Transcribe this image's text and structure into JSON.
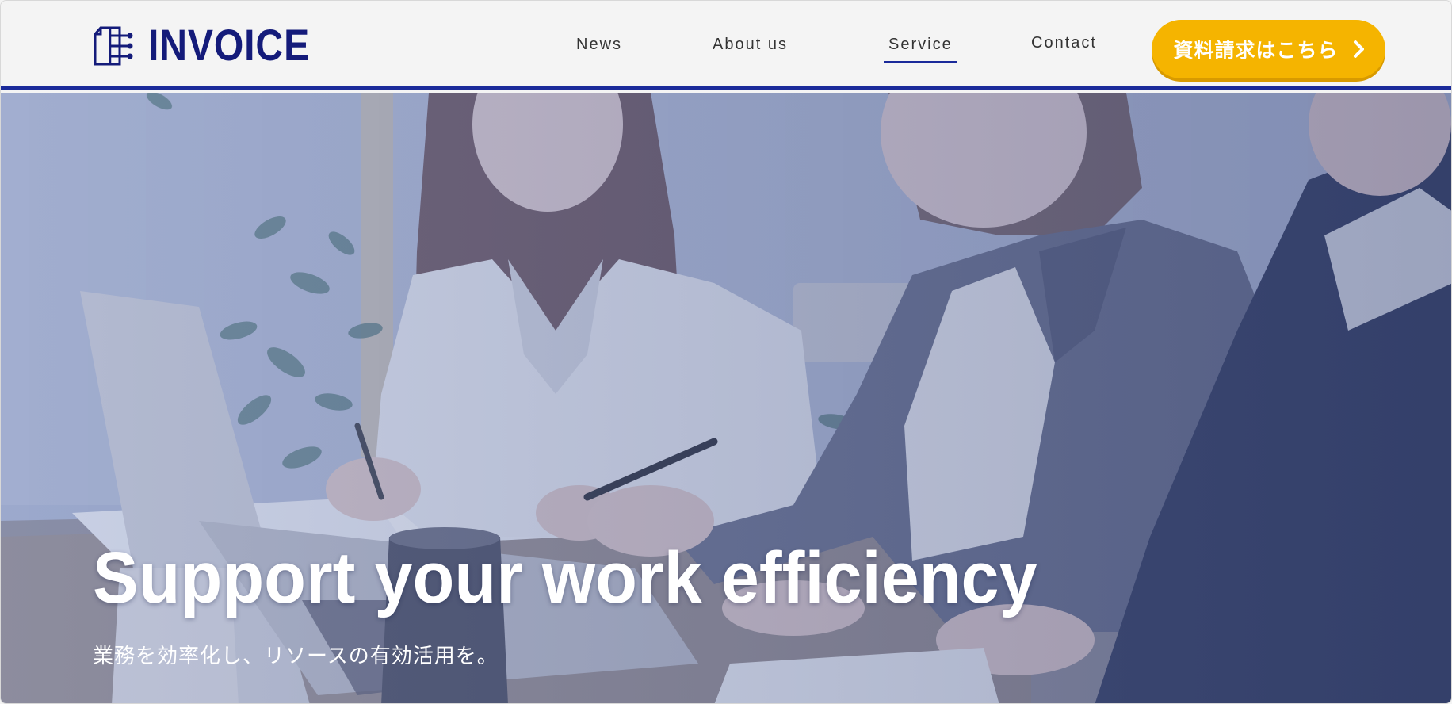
{
  "brand": {
    "name": "INVOICE",
    "color": "#141b7a",
    "accent": "#1a2a9a"
  },
  "nav": {
    "items": [
      {
        "label": "News"
      },
      {
        "label": "About us"
      },
      {
        "label": "Service",
        "active": true
      },
      {
        "label": "Contact"
      }
    ]
  },
  "cta": {
    "label": "資料請求はこちら",
    "icon": "chevron-right-icon",
    "color": "#f5b400"
  },
  "hero": {
    "title": "Support your work efficiency",
    "subtitle": "業務を効率化し、リソースの有効活用を。",
    "image": "office-meeting-photo"
  }
}
